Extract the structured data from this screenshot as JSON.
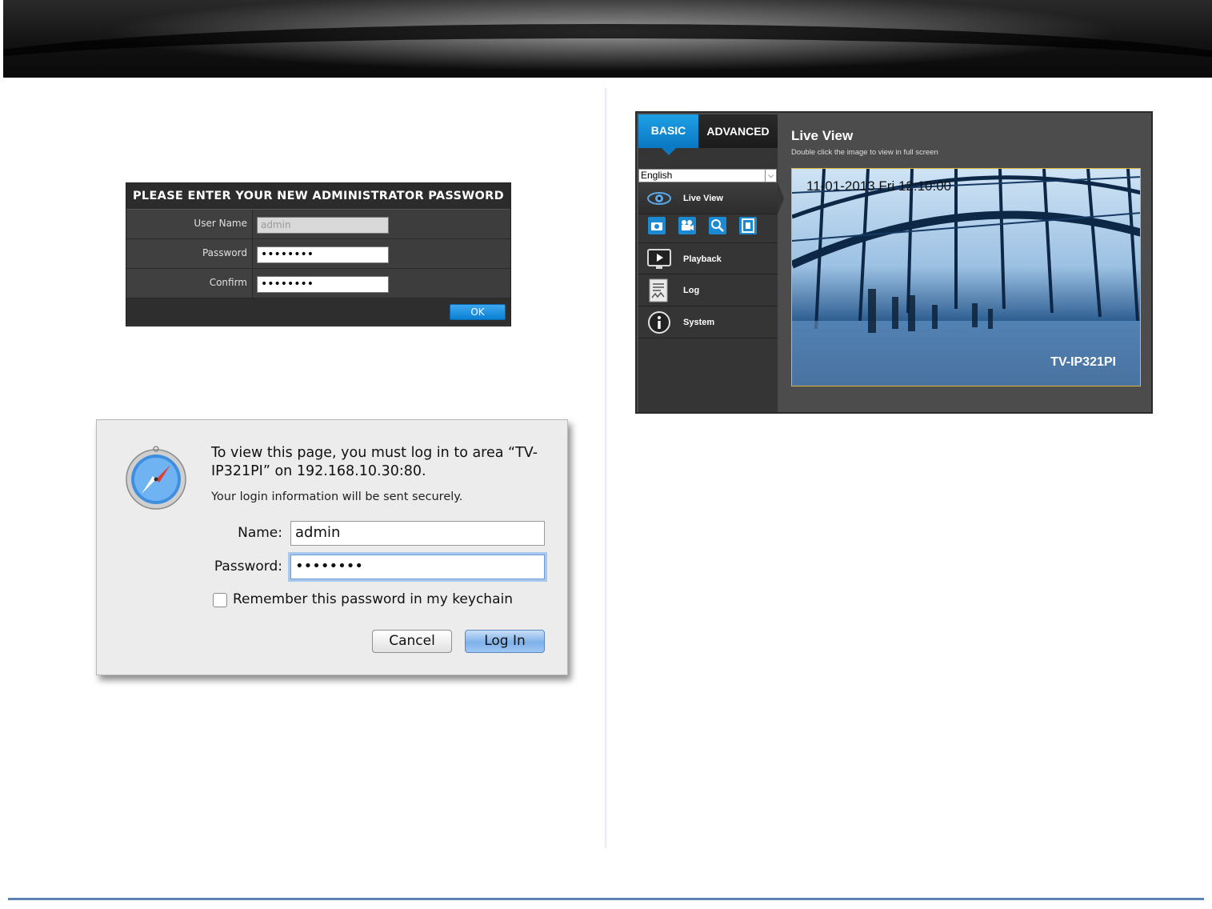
{
  "admin_panel": {
    "title": "PLEASE ENTER YOUR NEW ADMINISTRATOR PASSWORD",
    "fields": [
      {
        "label": "User Name",
        "value": "admin"
      },
      {
        "label": "Password",
        "value": "••••••••"
      },
      {
        "label": "Confirm",
        "value": "••••••••"
      }
    ],
    "ok_label": "OK"
  },
  "login_dialog": {
    "message_line1": "To view this page, you must log in to area “TV-",
    "message_line2": "IP321PI” on 192.168.10.30:80.",
    "secure_note": "Your login information will be sent securely.",
    "name_label": "Name:",
    "name_value": "admin",
    "password_label": "Password:",
    "password_value": "••••••••",
    "remember_label": "Remember this password in my keychain",
    "remember_checked": false,
    "cancel_label": "Cancel",
    "login_label": "Log In",
    "icon": "safari-compass-icon"
  },
  "camera_ui": {
    "tabs": {
      "basic": "BASIC",
      "advanced": "ADVANCED"
    },
    "language": "English",
    "nav": [
      {
        "label": "Live View",
        "icon": "eye-icon"
      },
      {
        "label": "Playback",
        "icon": "monitor-play-icon"
      },
      {
        "label": "Log",
        "icon": "document-icon"
      },
      {
        "label": "System",
        "icon": "info-icon"
      }
    ],
    "tools": [
      "camera-snapshot-icon",
      "video-record-icon",
      "zoom-icon",
      "film-icon"
    ],
    "main_title": "Live View",
    "main_subtitle": "Double click the image to view in full screen",
    "video_timestamp": "11-01-2013 Fri 12:10:00",
    "video_camera_name": "TV-IP321PI"
  },
  "colors": {
    "accent_blue": "#0a78c2",
    "divider_blue": "#5b84b5"
  }
}
